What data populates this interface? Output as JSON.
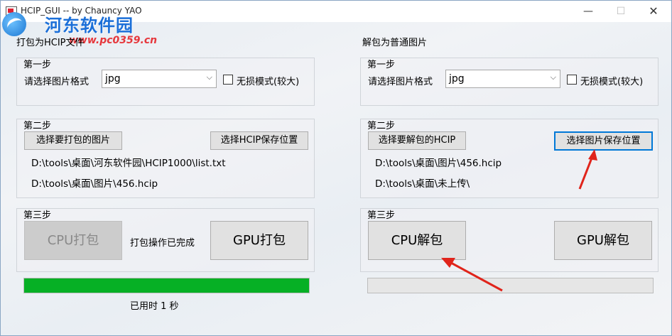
{
  "window": {
    "title": "HCIP_GUI -- by Chauncy YAO"
  },
  "watermark": {
    "brand": "河东软件园",
    "url": "www.pc0359.cn"
  },
  "left": {
    "section_title": "打包为HCIP文件",
    "step1": {
      "title": "第一步",
      "format_label": "请选择图片格式",
      "format_value": "jpg",
      "lossless_label": "无损模式(较大)"
    },
    "step2": {
      "title": "第二步",
      "select_images_button": "选择要打包的图片",
      "select_save_button": "选择HCIP保存位置",
      "source_path": "D:\\tools\\桌面\\河东软件园\\HCIP1000\\list.txt",
      "output_path": "D:\\tools\\桌面\\图片\\456.hcip"
    },
    "step3": {
      "title": "第三步",
      "cpu_button": "CPU打包",
      "status": "打包操作已完成",
      "gpu_button": "GPU打包"
    },
    "progress": {
      "value": 100,
      "elapsed": "已用时 1 秒"
    }
  },
  "right": {
    "section_title": "解包为普通图片",
    "step1": {
      "title": "第一步",
      "format_label": "请选择图片格式",
      "format_value": "jpg",
      "lossless_label": "无损模式(较大)"
    },
    "step2": {
      "title": "第二步",
      "select_hcip_button": "选择要解包的HCIP",
      "select_save_button": "选择图片保存位置",
      "source_path": "D:\\tools\\桌面\\图片\\456.hcip",
      "output_path": "D:\\tools\\桌面\\未上传\\"
    },
    "step3": {
      "title": "第三步",
      "cpu_button": "CPU解包",
      "gpu_button": "GPU解包"
    },
    "progress": {
      "value": 0
    }
  },
  "colors": {
    "accent": "#0078d7",
    "progress": "#06b025",
    "annotation_arrow": "#e0241b"
  }
}
